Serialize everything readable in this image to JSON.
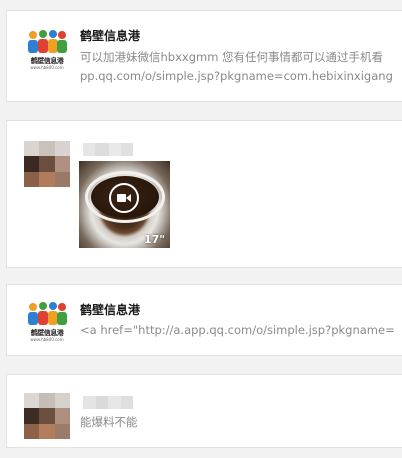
{
  "feed": {
    "items": [
      {
        "type": "text",
        "author": "鹤壁信息港",
        "avatar": {
          "kind": "logo",
          "caption": "鹤壁信息港",
          "url": "www.hb800.com"
        },
        "lines": [
          "可以加港妹微信hbxxgmm 您有任何事情都可以通过手机看",
          "pp.qq.com/o/simple.jsp?pkgname=com.hebixinxigang"
        ]
      },
      {
        "type": "video",
        "author_blurred": true,
        "avatar": {
          "kind": "pixelated"
        },
        "video": {
          "duration": "17\"",
          "play_icon": "video-camera-icon"
        }
      },
      {
        "type": "text",
        "author": "鹤壁信息港",
        "avatar": {
          "kind": "logo",
          "caption": "鹤壁信息港",
          "url": "www.hb800.com"
        },
        "lines": [
          "<a href=\"http://a.app.qq.com/o/simple.jsp?pkgname="
        ]
      },
      {
        "type": "text",
        "author_blurred": true,
        "avatar": {
          "kind": "pixelated"
        },
        "lines": [
          "能爆料不能"
        ]
      }
    ]
  },
  "colors": {
    "background": "#f2f2f2",
    "card": "#ffffff",
    "border": "#e3e3e3",
    "name": "#1a1a1a",
    "message": "#8a8a8a"
  }
}
